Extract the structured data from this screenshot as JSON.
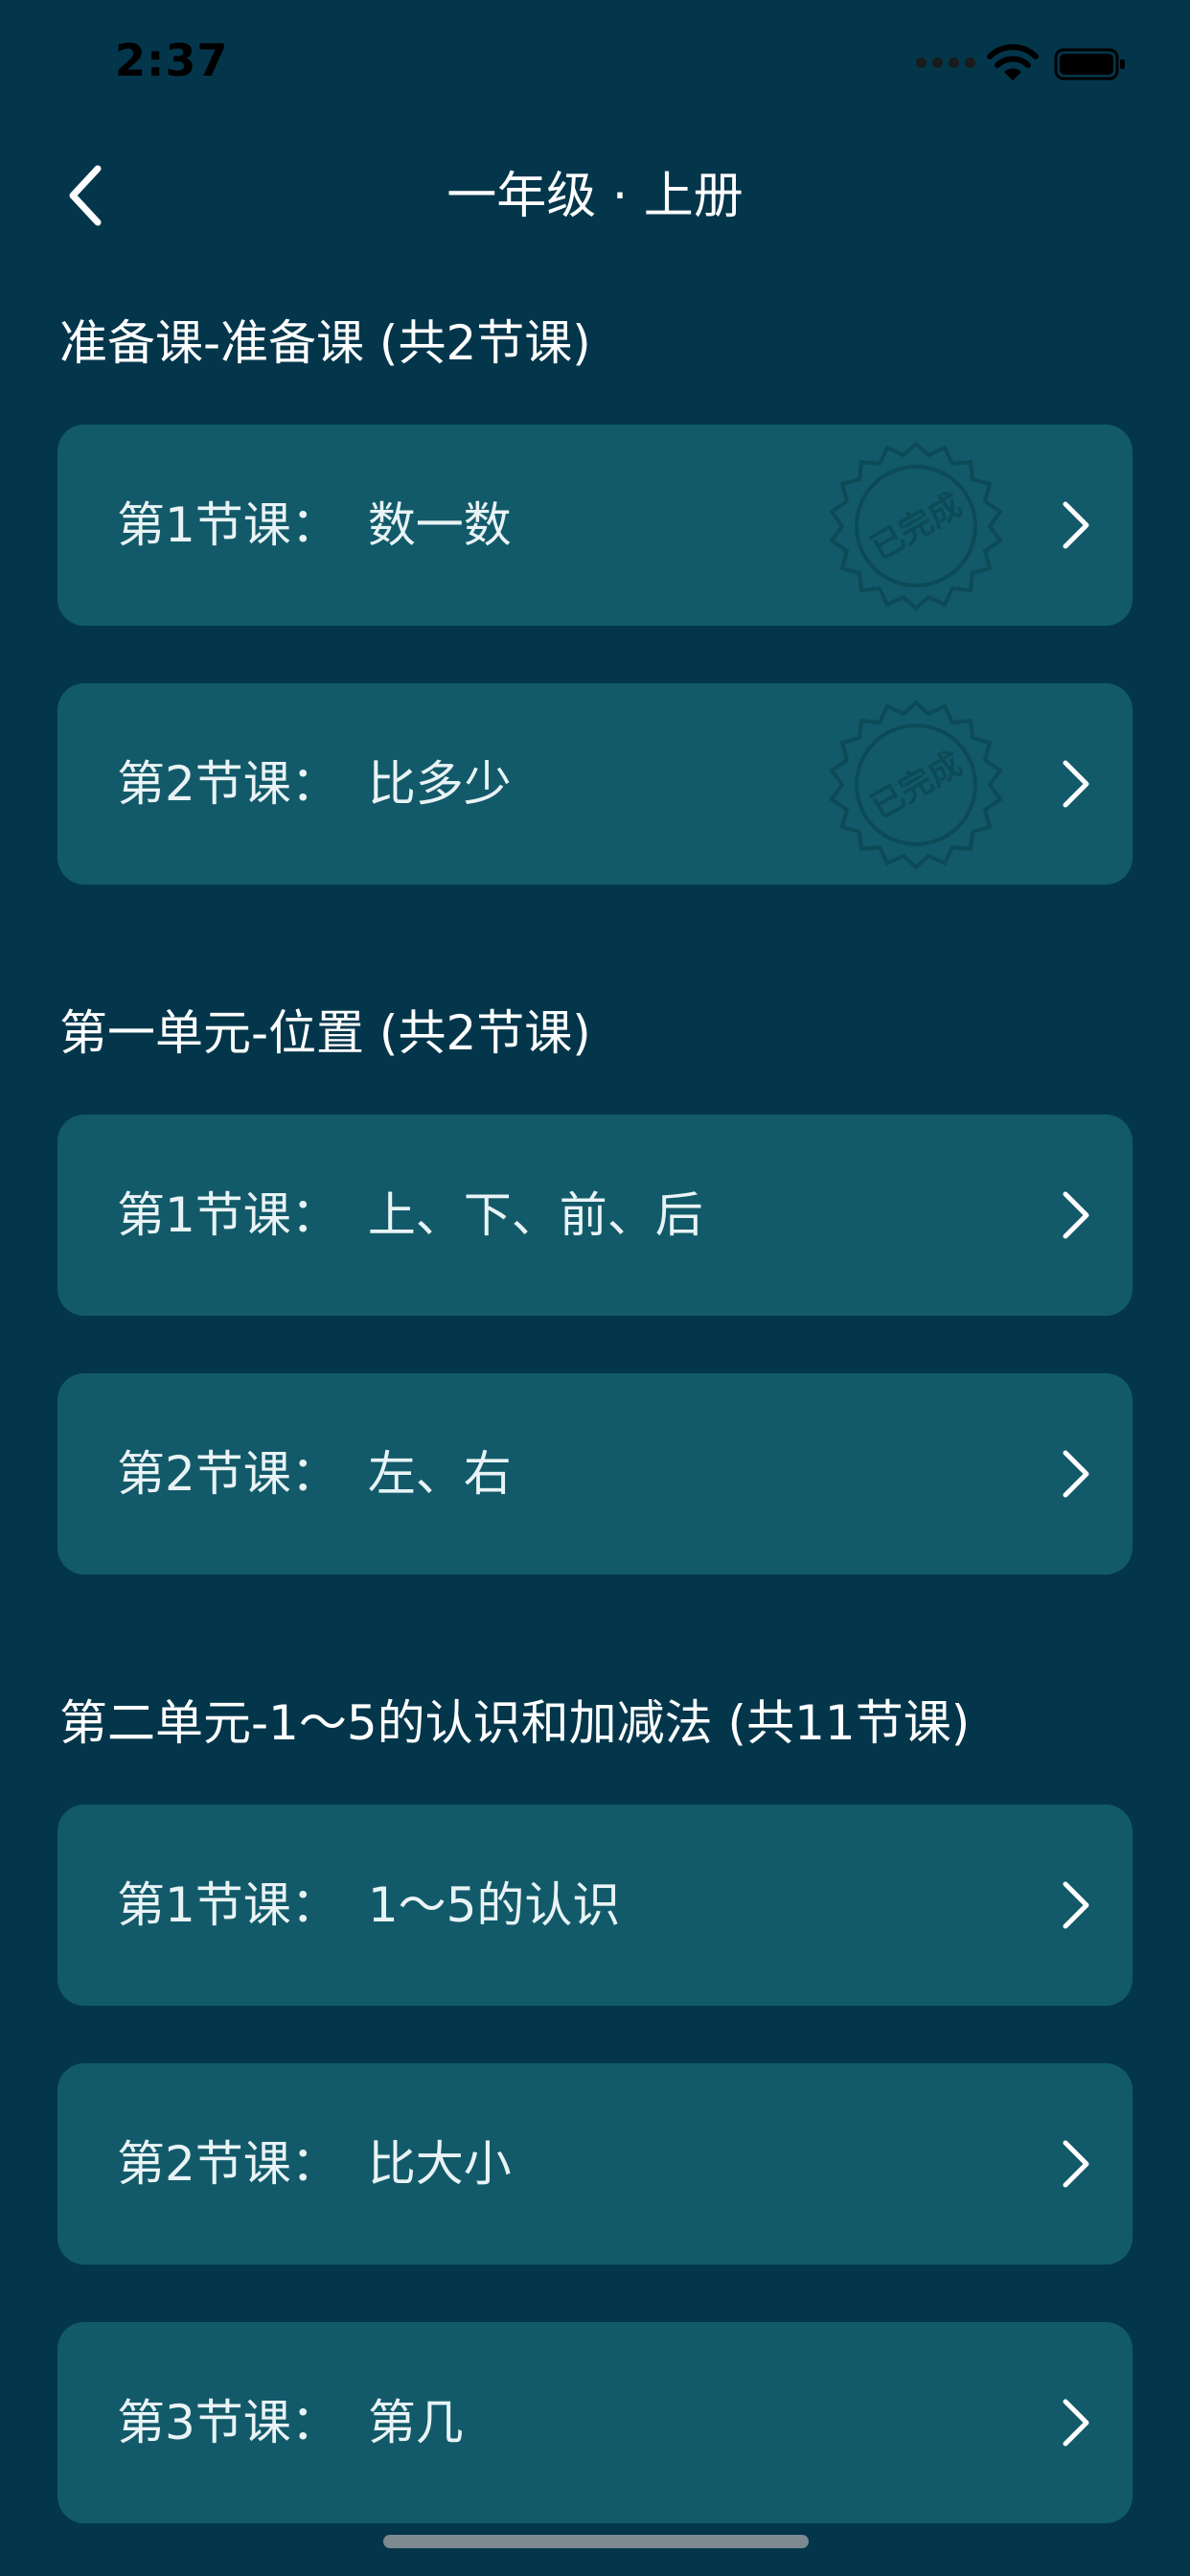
{
  "status_bar": {
    "time": "2:37"
  },
  "nav": {
    "title": "一年级 · 上册"
  },
  "sections": [
    {
      "title": "准备课-准备课 (共2节课)",
      "lessons": [
        {
          "number": "第1节课：",
          "name": "数一数",
          "completed": true,
          "stamp_text": "已完成"
        },
        {
          "number": "第2节课：",
          "name": "比多少",
          "completed": true,
          "stamp_text": "已完成"
        }
      ]
    },
    {
      "title": "第一单元-位置 (共2节课)",
      "lessons": [
        {
          "number": "第1节课：",
          "name": "上、下、前、后",
          "completed": false
        },
        {
          "number": "第2节课：",
          "name": "左、右",
          "completed": false
        }
      ]
    },
    {
      "title": "第二单元-1～5的认识和加减法 (共11节课)",
      "lessons": [
        {
          "number": "第1节课：",
          "name": "1～5的认识",
          "completed": false
        },
        {
          "number": "第2节课：",
          "name": "比大小",
          "completed": false
        },
        {
          "number": "第3节课：",
          "name": "第几",
          "completed": false
        }
      ]
    }
  ],
  "colors": {
    "background": "#03364b",
    "card": "#125a69",
    "text": "#ffffff",
    "stamp": "#0d4a57"
  },
  "icons": [
    "back-chevron-icon",
    "chevron-right-icon",
    "completed-stamp-icon",
    "wifi-icon",
    "battery-icon",
    "signal-icon"
  ]
}
